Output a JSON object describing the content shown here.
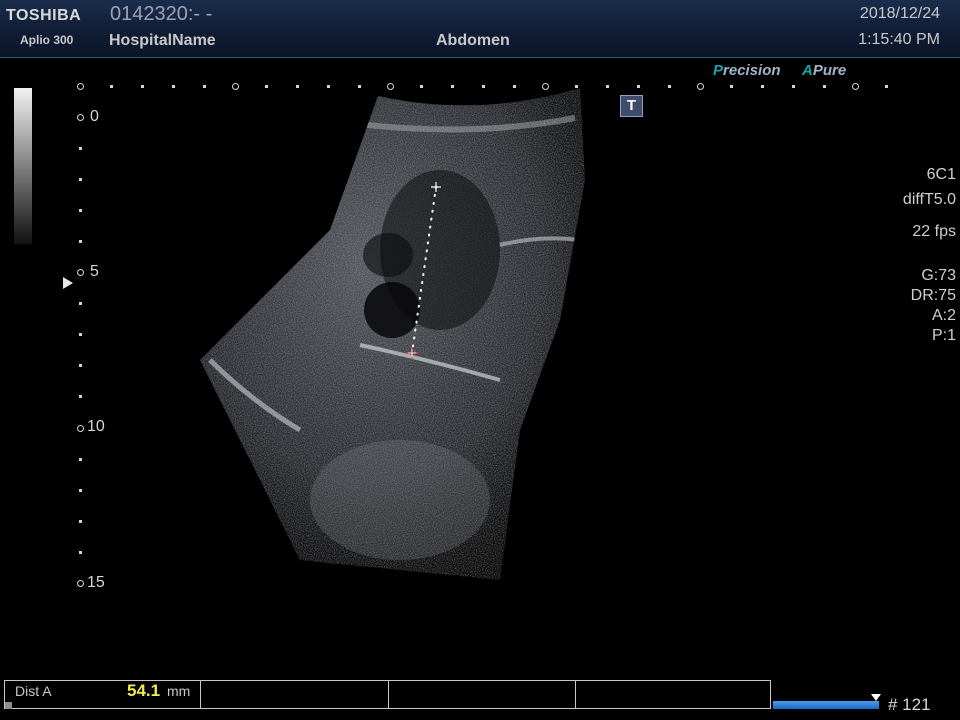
{
  "header": {
    "brand": "TOSHIBA",
    "model": "Aplio 300",
    "patient_id": "0142320:- -",
    "hospital": "HospitalName",
    "exam": "Abdomen",
    "date": "2018/12/24",
    "time": "1:15:40 PM"
  },
  "badges": {
    "precision": "Precision",
    "apure_a": "A",
    "apure_rest": "Pure"
  },
  "scale": {
    "depth_labels": [
      "0",
      "5",
      "10",
      "15"
    ]
  },
  "params": {
    "probe": "6C1",
    "mode": "diffT5.0",
    "fps": "22 fps",
    "gain": "G:73",
    "dynamic_range": "DR:75",
    "a": "A:2",
    "p": "P:1"
  },
  "measurement": {
    "label": "Dist A",
    "value": "54.1",
    "unit": "mm"
  },
  "cine": {
    "frame": "# 121"
  },
  "t_icon": "T",
  "colors": {
    "header_bg": "#13223f",
    "measurement_value": "#f2ea4e",
    "badge_accent": "#1fa0a8",
    "cine_bar": "#1769c8"
  }
}
